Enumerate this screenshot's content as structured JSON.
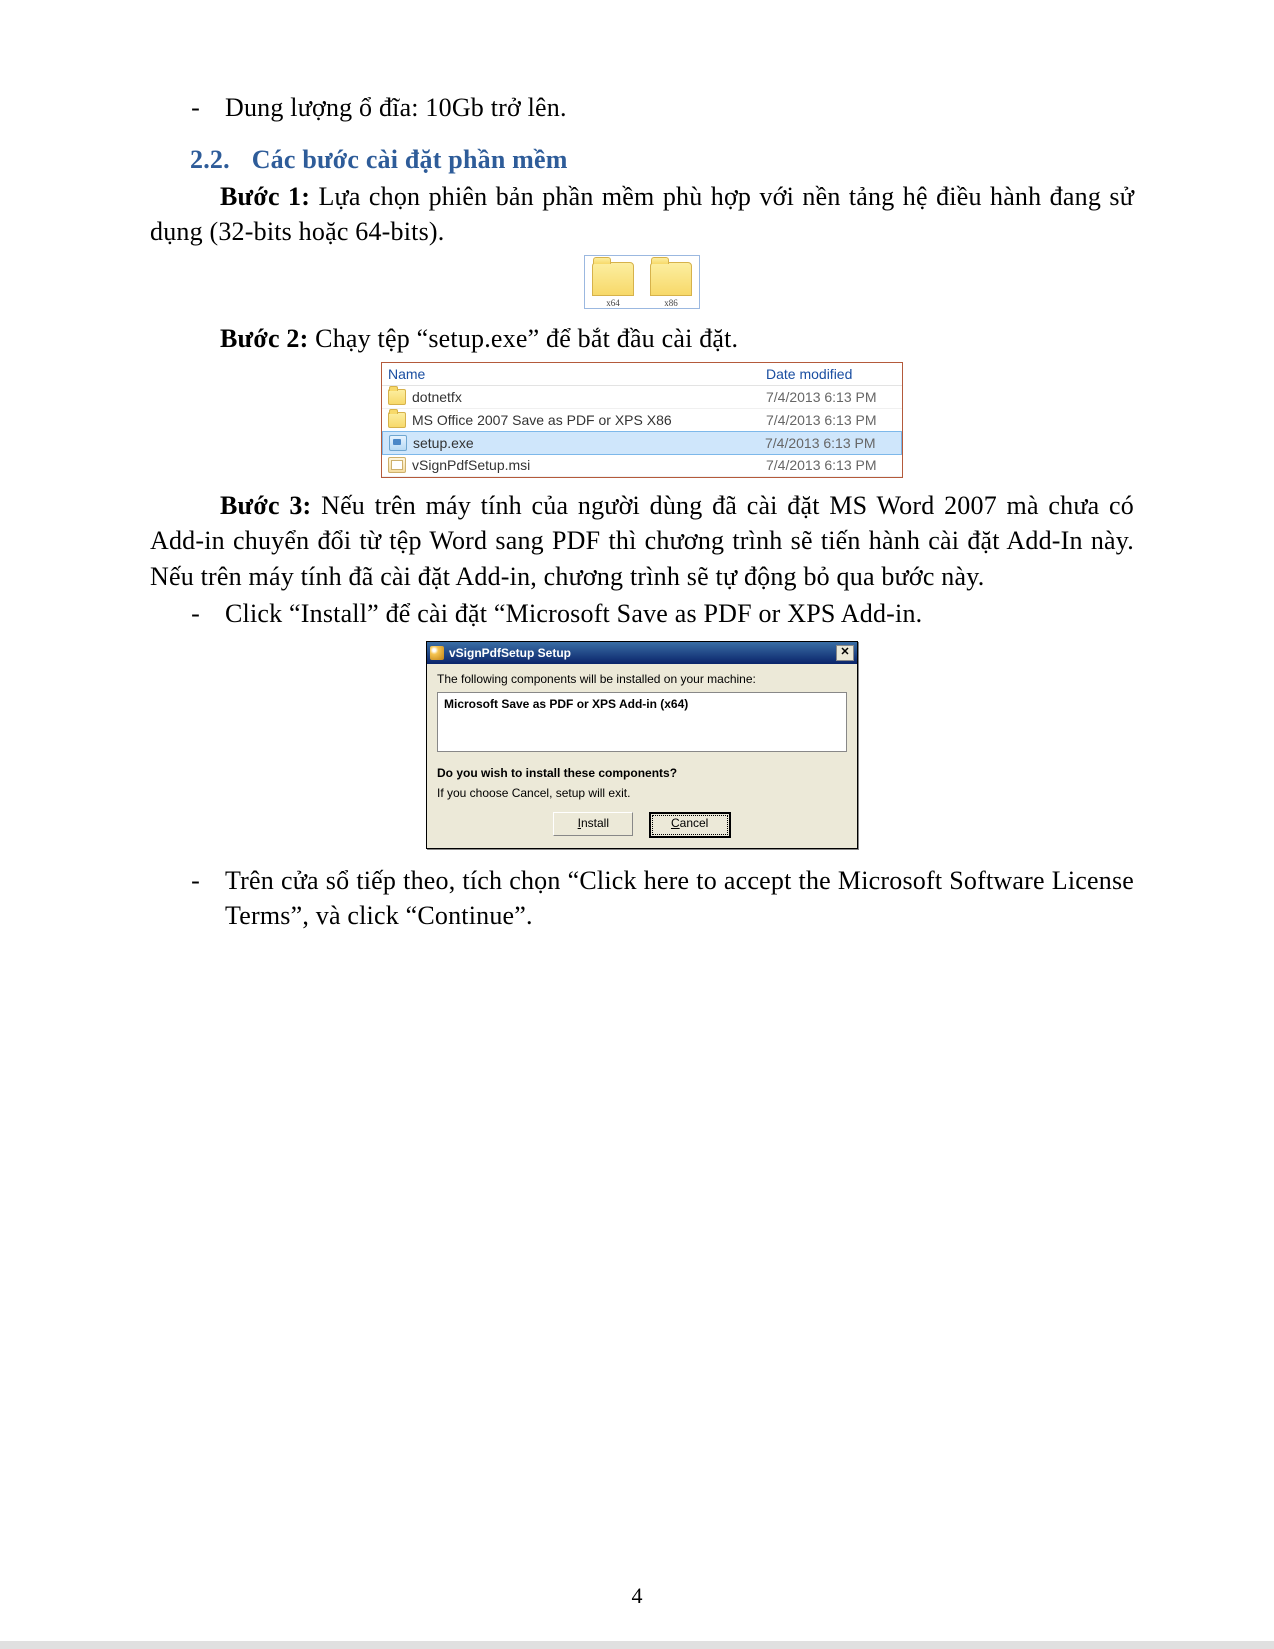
{
  "body": {
    "bullet1": "Dung lượng ổ đĩa: 10Gb trở lên.",
    "sectionNumber": "2.2.",
    "sectionTitle": "Các bước cài đặt phần mềm",
    "step1_label": "Bước 1:",
    "step1_text": " Lựa chọn phiên bản phần mềm phù hợp với nền tảng hệ điều hành đang sử dụng (32-bits hoặc 64-bits).",
    "step2_label": "Bước 2:",
    "step2_text": " Chạy tệp “setup.exe” để bắt đầu cài đặt.",
    "step3_label": "Bước 3:",
    "step3_text": " Nếu trên máy tính của người dùng đã cài đặt MS Word 2007 mà chưa có Add-in chuyển đổi từ tệp Word sang PDF thì chương trình sẽ tiến hành cài đặt Add-In này. Nếu trên máy tính đã cài đặt Add-in, chương trình sẽ tự động bỏ qua bước này.",
    "substep3a": "Click “Install” để cài đặt “Microsoft Save as PDF or XPS Add-in.",
    "substep3b": "Trên cửa sổ tiếp theo, tích chọn “Click here to accept the Microsoft Software License Terms”, và click “Continue”."
  },
  "folders": {
    "items": [
      "x64",
      "x86"
    ]
  },
  "filelist": {
    "header_name": "Name",
    "header_date": "Date modified",
    "rows": [
      {
        "icon": "folder",
        "name": "dotnetfx",
        "date": "7/4/2013 6:13 PM",
        "selected": false
      },
      {
        "icon": "folder",
        "name": "MS Office 2007 Save as PDF or XPS X86",
        "date": "7/4/2013 6:13 PM",
        "selected": false
      },
      {
        "icon": "exe",
        "name": "setup.exe",
        "date": "7/4/2013 6:13 PM",
        "selected": true
      },
      {
        "icon": "msi",
        "name": "vSignPdfSetup.msi",
        "date": "7/4/2013 6:13 PM",
        "selected": false
      }
    ]
  },
  "dialog": {
    "title": "vSignPdfSetup Setup",
    "msg": "The following components will be installed on your machine:",
    "component": "Microsoft Save as PDF or XPS Add-in (x64)",
    "question": "Do you wish to install these components?",
    "cancel_note": "If you choose Cancel, setup will exit.",
    "install_pre": "",
    "install_u": "I",
    "install_post": "nstall",
    "cancel_pre": "",
    "cancel_u": "C",
    "cancel_post": "ancel",
    "close_glyph": "✕"
  },
  "pagenum": "4"
}
